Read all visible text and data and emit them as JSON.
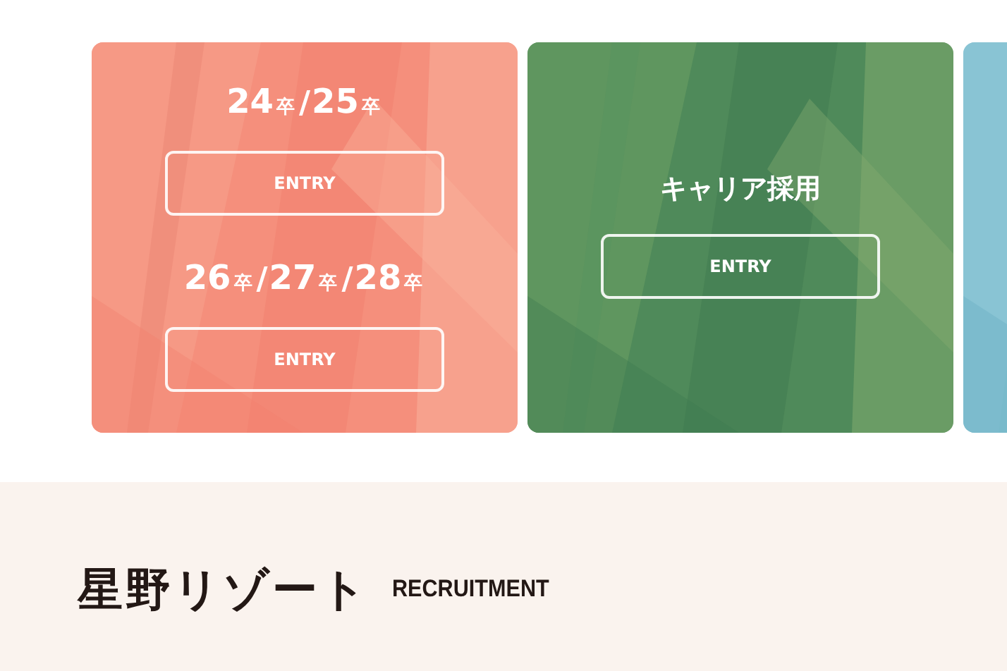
{
  "cards": [
    {
      "kind": "entry",
      "sections": [
        {
          "heading": [
            {
              "kind": "num",
              "text": "24"
            },
            {
              "kind": "unit",
              "text": "卒"
            },
            {
              "kind": "sep",
              "text": "/"
            },
            {
              "kind": "num",
              "text": "25"
            },
            {
              "kind": "unit",
              "text": "卒"
            }
          ],
          "button": "ENTRY"
        },
        {
          "heading": [
            {
              "kind": "num",
              "text": "26"
            },
            {
              "kind": "unit",
              "text": "卒"
            },
            {
              "kind": "sep",
              "text": "/"
            },
            {
              "kind": "num",
              "text": "27"
            },
            {
              "kind": "unit",
              "text": "卒"
            },
            {
              "kind": "sep",
              "text": "/"
            },
            {
              "kind": "num",
              "text": "28"
            },
            {
              "kind": "unit",
              "text": "卒"
            }
          ],
          "button": "ENTRY"
        }
      ]
    },
    {
      "kind": "entry",
      "sections": [
        {
          "heading": [
            {
              "kind": "text",
              "text": "キャリア採用"
            }
          ],
          "button": "ENTRY"
        }
      ]
    },
    {
      "kind": "picture"
    }
  ],
  "footer": {
    "logo": "星野リゾート",
    "tagline": "RECRUITMENT"
  }
}
